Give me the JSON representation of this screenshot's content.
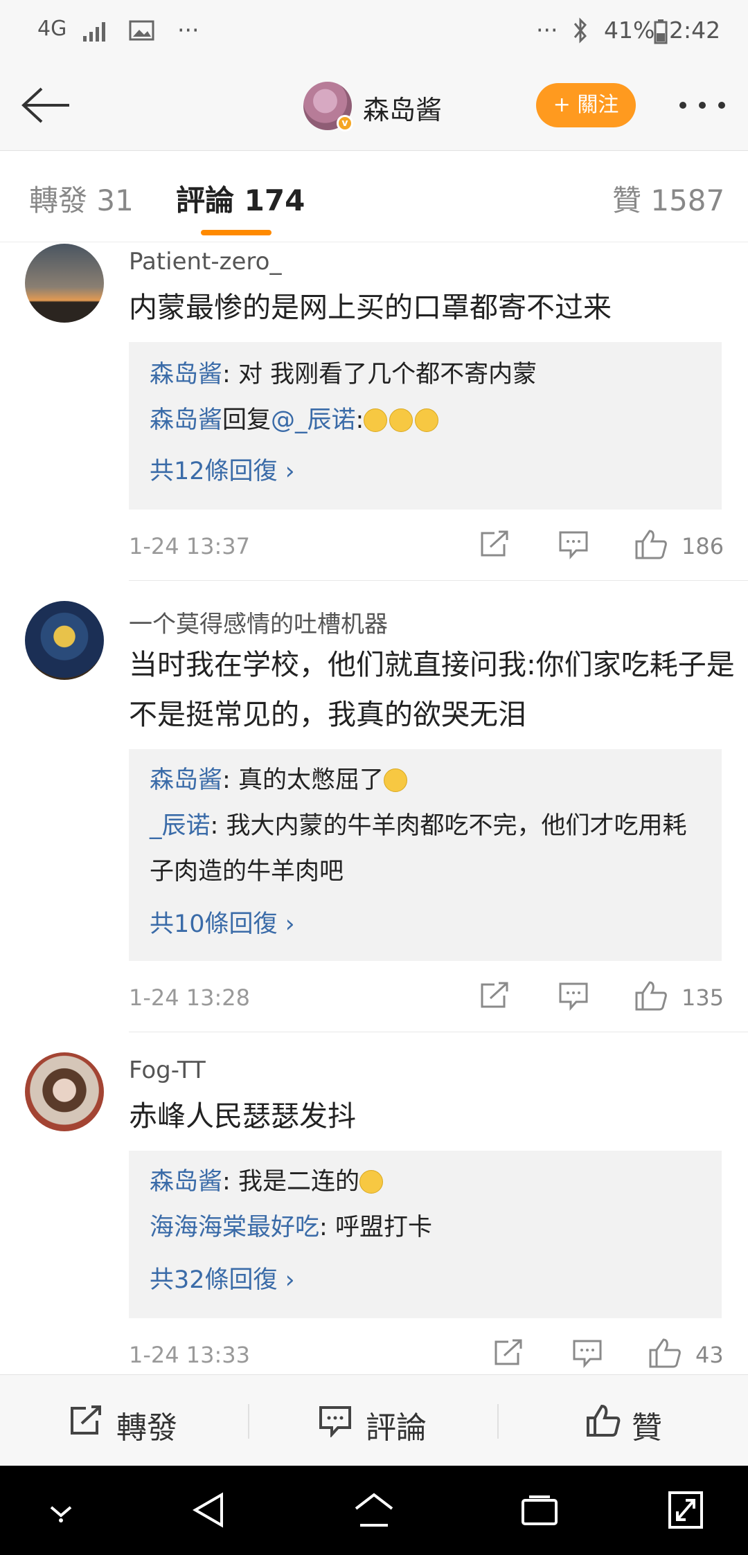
{
  "status_bar": {
    "network": "4G",
    "battery": "41%",
    "time": "2:42",
    "dots": "···"
  },
  "header": {
    "username": "森岛酱",
    "follow_label": "+ 關注"
  },
  "tabs": {
    "repost": "轉發 31",
    "comments": "評論 174",
    "likes": "贊 1587"
  },
  "comments": [
    {
      "username": "Patient-zero_",
      "text": "内蒙最惨的是网上买的口罩都寄不过来",
      "replies": [
        {
          "author": "森岛酱",
          "sep": ": ",
          "text": "对 我刚看了几个都不寄内蒙"
        },
        {
          "author": "森岛酱",
          "mid": "回复",
          "mention": "@_辰诺",
          "sep": ":",
          "text": ""
        }
      ],
      "more": "共12條回復 ›",
      "time": "1-24 13:37",
      "likes": "186"
    },
    {
      "username": "一个莫得感情的吐槽机器",
      "text": "当时我在学校，他们就直接问我:你们家吃耗子是不是挺常见的，我真的欲哭无泪",
      "replies": [
        {
          "author": "森岛酱",
          "sep": ": ",
          "text": "真的太憋屈了"
        },
        {
          "author": "_辰诺",
          "sep": ": ",
          "text": "我大内蒙的牛羊肉都吃不完，他们才吃用耗子肉造的牛羊肉吧"
        }
      ],
      "more": "共10條回復 ›",
      "time": "1-24 13:28",
      "likes": "135"
    },
    {
      "username": "Fog-TT",
      "text": "赤峰人民瑟瑟发抖",
      "replies": [
        {
          "author": "森岛酱",
          "sep": ": ",
          "text": "我是二连的"
        },
        {
          "author": "海海海棠最好吃",
          "sep": ": ",
          "text": "呼盟打卡"
        }
      ],
      "more": "共32條回復 ›",
      "time": "1-24 13:33",
      "likes": "43"
    }
  ],
  "bottom_bar": {
    "repost": "轉發",
    "comment": "評論",
    "like": "贊"
  },
  "colors": {
    "accent": "#ff9a1f",
    "link": "#3a6ba8",
    "tab_indicator": "#ff8a00"
  }
}
